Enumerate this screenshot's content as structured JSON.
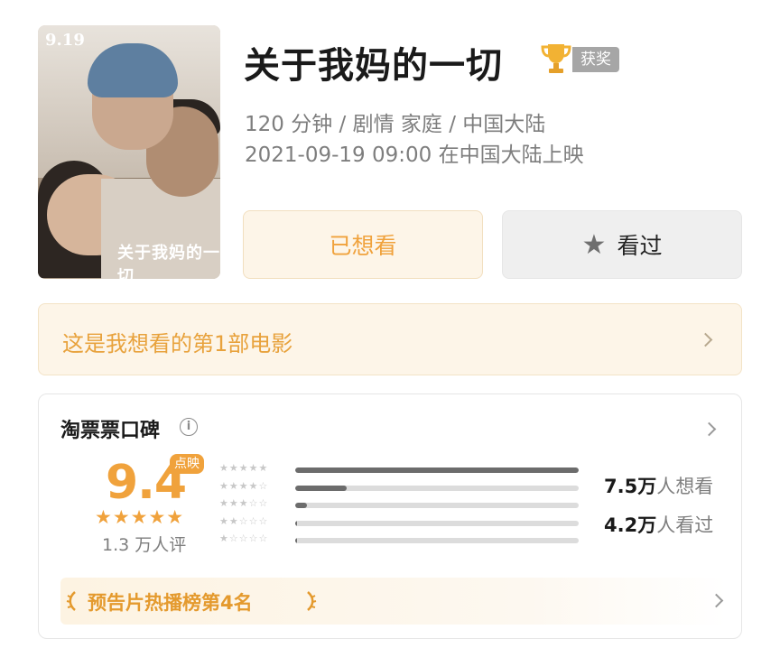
{
  "movie": {
    "title": "关于我妈的一切",
    "award_tag": "获奖",
    "meta_line1": "120 分钟 / 剧情 家庭 / 中国大陆",
    "meta_line2": "2021-09-19 09:00 在中国大陆上映",
    "poster": {
      "date": "9.19",
      "title_art": "关于我妈的一切"
    }
  },
  "actions": {
    "want_label": "已想看",
    "seen_label": "看过"
  },
  "banner": {
    "text": "这是我想看的第1部电影"
  },
  "rating": {
    "title": "淘票票口碑",
    "info_icon_text": "i",
    "score": "9.4",
    "score_badge": "点映",
    "score_stars": "★★★★★",
    "score_count": "1.3 万人评",
    "distribution": [
      {
        "stars": "★★★★★",
        "level": 1.0
      },
      {
        "stars": "★★★★☆",
        "level": 0.18
      },
      {
        "stars": "★★★☆☆",
        "level": 0.04
      },
      {
        "stars": "★★☆☆☆",
        "level": 0.005
      },
      {
        "stars": "★☆☆☆☆",
        "level": 0.005
      }
    ],
    "stats": {
      "want_num": "7.5万",
      "want_label": "人想看",
      "seen_num": "4.2万",
      "seen_label": "人看过"
    },
    "rank_text": "预告片热播榜第4名"
  },
  "colors": {
    "accent": "#f0a23c",
    "banner_bg": "#fdf5e8",
    "muted": "#7e7e7e"
  },
  "icons": [
    "trophy-icon",
    "star-icon",
    "info-icon",
    "chevron-right-icon",
    "laurel-left-icon",
    "laurel-right-icon"
  ]
}
